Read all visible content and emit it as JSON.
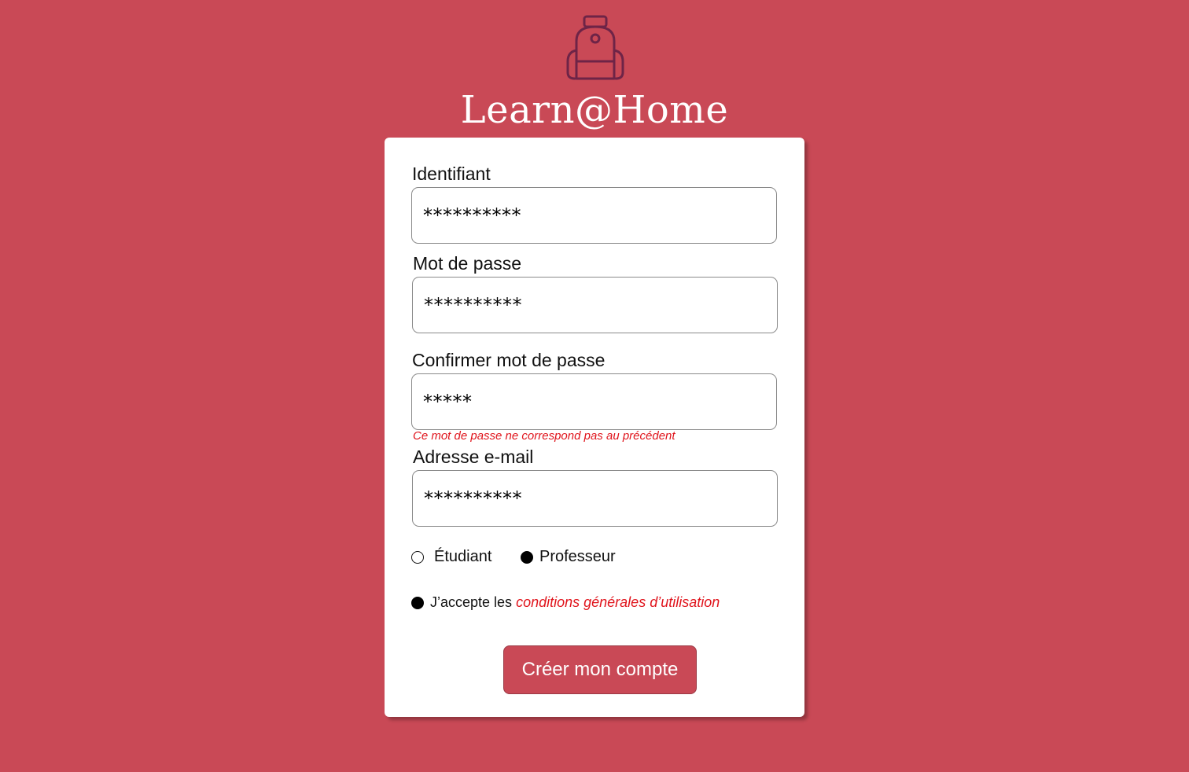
{
  "app": {
    "brand_name": "Learn@Home",
    "logo_icon": "backpack-icon"
  },
  "colors": {
    "background": "#c94956",
    "card": "#ffffff",
    "error": "#e0141c",
    "button": "#c94956",
    "logo_stroke": "#6e2447"
  },
  "form": {
    "fields": [
      {
        "label": "Identifiant",
        "value": "**********"
      },
      {
        "label": "Mot de passe",
        "value": "**********"
      },
      {
        "label": "Confirmer mot de passe",
        "value": "*****",
        "error": "Ce mot de passe ne correspond pas au précédent"
      },
      {
        "label": "Adresse e-mail",
        "value": "**********"
      }
    ],
    "roles": [
      {
        "label": "Étudiant",
        "selected": false
      },
      {
        "label": "Professeur",
        "selected": true
      }
    ],
    "terms": {
      "prefix": "J’accepte les",
      "link": "conditions générales d’utilisation",
      "checked": true
    },
    "submit_label": "Créer mon compte"
  }
}
